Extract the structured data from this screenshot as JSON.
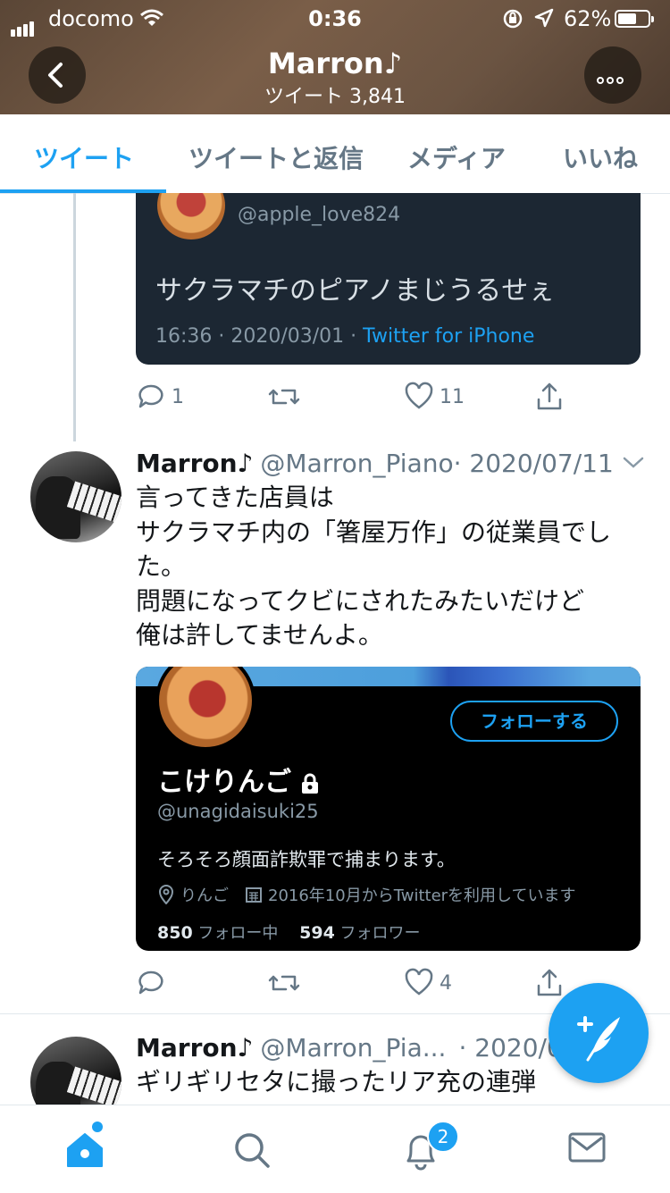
{
  "status_bar": {
    "carrier": "docomo",
    "time": "0:36",
    "battery_percent": "62%",
    "battery_level": 0.62
  },
  "header": {
    "profile_name": "Marron♪",
    "tweet_count_label": "ツイート 3,841"
  },
  "tabs": [
    {
      "label": "ツイート",
      "active": true
    },
    {
      "label": "ツイートと返信",
      "active": false
    },
    {
      "label": "メディア",
      "active": false
    },
    {
      "label": "いいね",
      "active": false
    }
  ],
  "tweets": [
    {
      "quoted": {
        "handle": "@apple_love824",
        "text": "サクラマチのピアノまじうるせぇ",
        "timestamp": "16:36 · 2020/03/01 · ",
        "app": "Twitter for iPhone"
      },
      "actions": {
        "replies": "1",
        "retweets": "",
        "likes": "11"
      }
    },
    {
      "name": "Marron♪",
      "handle": "@Marron_Piano",
      "date": "· 2020/07/11",
      "body_lines": [
        "言ってきた店員は",
        "サクラマチ内の「箸屋万作」の従業員でし",
        "た。",
        "問題になってクビにされたみたいだけど",
        "俺は許してませんよ。"
      ],
      "image_card": {
        "follow_label": "フォローする",
        "name": "こけりんご",
        "handle": "@unagidaisuki25",
        "bio": "そろそろ顔面詐欺罪で捕まります。",
        "location": "りんご",
        "joined": "2016年10月からTwitterを利用しています",
        "following_count": "850",
        "following_label": "フォロー中",
        "followers_count": "594",
        "followers_label": "フォロワー"
      },
      "actions": {
        "replies": "",
        "retweets": "",
        "likes": "4"
      }
    },
    {
      "name": "Marron♪",
      "handle": "@Marron_Pia...",
      "date": "· 2020/0",
      "body_lines": [
        "ギリギリセタに撮ったリア充の連弾"
      ]
    }
  ],
  "bottom_nav": {
    "notification_badge": "2"
  },
  "colors": {
    "accent": "#1da1f2",
    "card_dark": "#1c2733",
    "muted": "#657786"
  }
}
